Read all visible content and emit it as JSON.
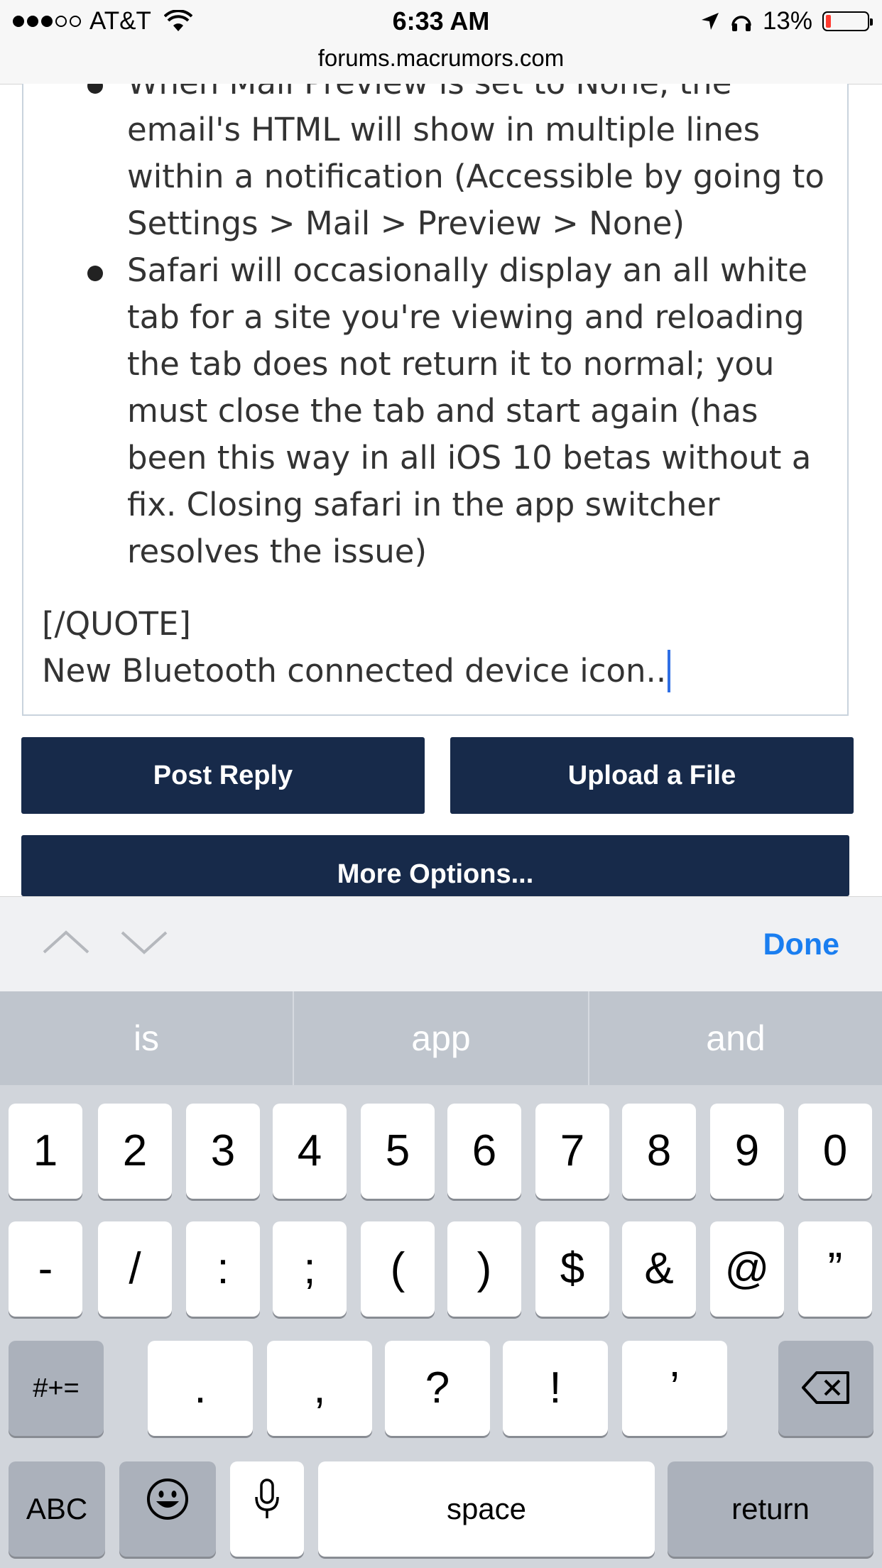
{
  "status_bar": {
    "carrier": "AT&T",
    "time": "6:33 AM",
    "battery": "13%",
    "battery_level": 0.13,
    "battery_color": "#ff3b30",
    "url": "forums.macrumors.com",
    "icons": [
      "signal-dots",
      "wifi-icon",
      "location-arrow-icon",
      "headphones-icon",
      "battery-icon"
    ]
  },
  "editor": {
    "bullets": [
      "When Mail Preview is set to None, the email's HTML will show in multiple lines within a notification (Accessible by going to Settings > Mail > Preview > None)",
      "Safari will occasionally display an all white tab for a site you're viewing and reloading the tab does not return it to normal; you must close the tab and start again (has been this way in all iOS 10 betas without a fix. Closing safari in the app switcher resolves the issue)"
    ],
    "quote_close": "[/QUOTE]",
    "reply_text": "New Bluetooth connected device icon.."
  },
  "buttons": {
    "post_reply": "Post Reply",
    "upload_file": "Upload a File",
    "more_options": "More Options..."
  },
  "accessory": {
    "done": "Done",
    "icons": [
      "chevron-up-icon",
      "chevron-down-icon"
    ]
  },
  "keyboard": {
    "predictions": [
      "is",
      "app",
      "and"
    ],
    "row1": [
      "1",
      "2",
      "3",
      "4",
      "5",
      "6",
      "7",
      "8",
      "9",
      "0"
    ],
    "row2": [
      "-",
      "/",
      ":",
      ";",
      "(",
      ")",
      "$",
      "&",
      "@",
      "”"
    ],
    "row3": {
      "shift": "#+=",
      "keys": [
        ".",
        ",",
        "?",
        "!",
        "’"
      ]
    },
    "row4": {
      "abc": "ABC",
      "space": "space",
      "return": "return"
    },
    "colors": {
      "accent": "#1a7ef0",
      "button_bg": "#172a4a"
    }
  }
}
